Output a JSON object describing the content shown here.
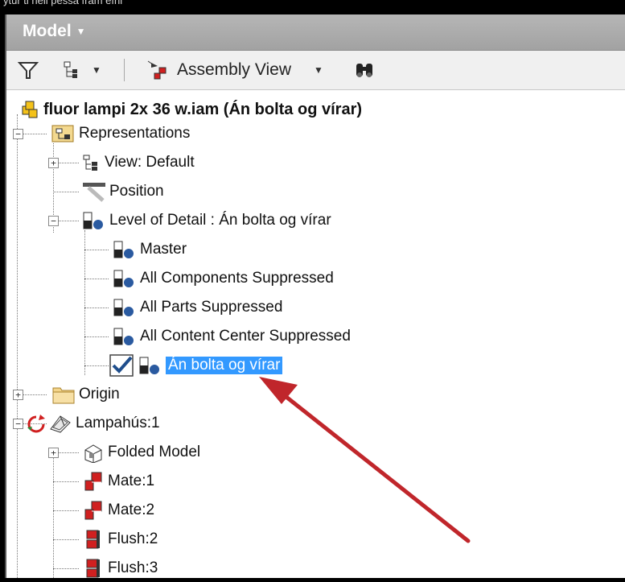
{
  "caption": "ytur ti heil pessa fram efni",
  "panel": {
    "title": "Model"
  },
  "toolbar": {
    "view_label": "Assembly View"
  },
  "tree": {
    "root": "fluor lampi 2x 36 w.iam (Án bolta og vírar)",
    "representations": "Representations",
    "view_default": "View: Default",
    "position": "Position",
    "level_of_detail": "Level of Detail : Án bolta og vírar",
    "master": "Master",
    "all_components": "All Components Suppressed",
    "all_parts": "All Parts Suppressed",
    "all_content_center": "All Content Center Suppressed",
    "active_lod": "Án bolta og vírar",
    "origin": "Origin",
    "lampahus": "Lampahús:1",
    "folded_model": "Folded Model",
    "mate1": "Mate:1",
    "mate2": "Mate:2",
    "flush2": "Flush:2",
    "flush3": "Flush:3"
  },
  "colors": {
    "annotation_arrow": "#c0262b",
    "selection": "#3399ff",
    "header": "#a9a9a9"
  }
}
